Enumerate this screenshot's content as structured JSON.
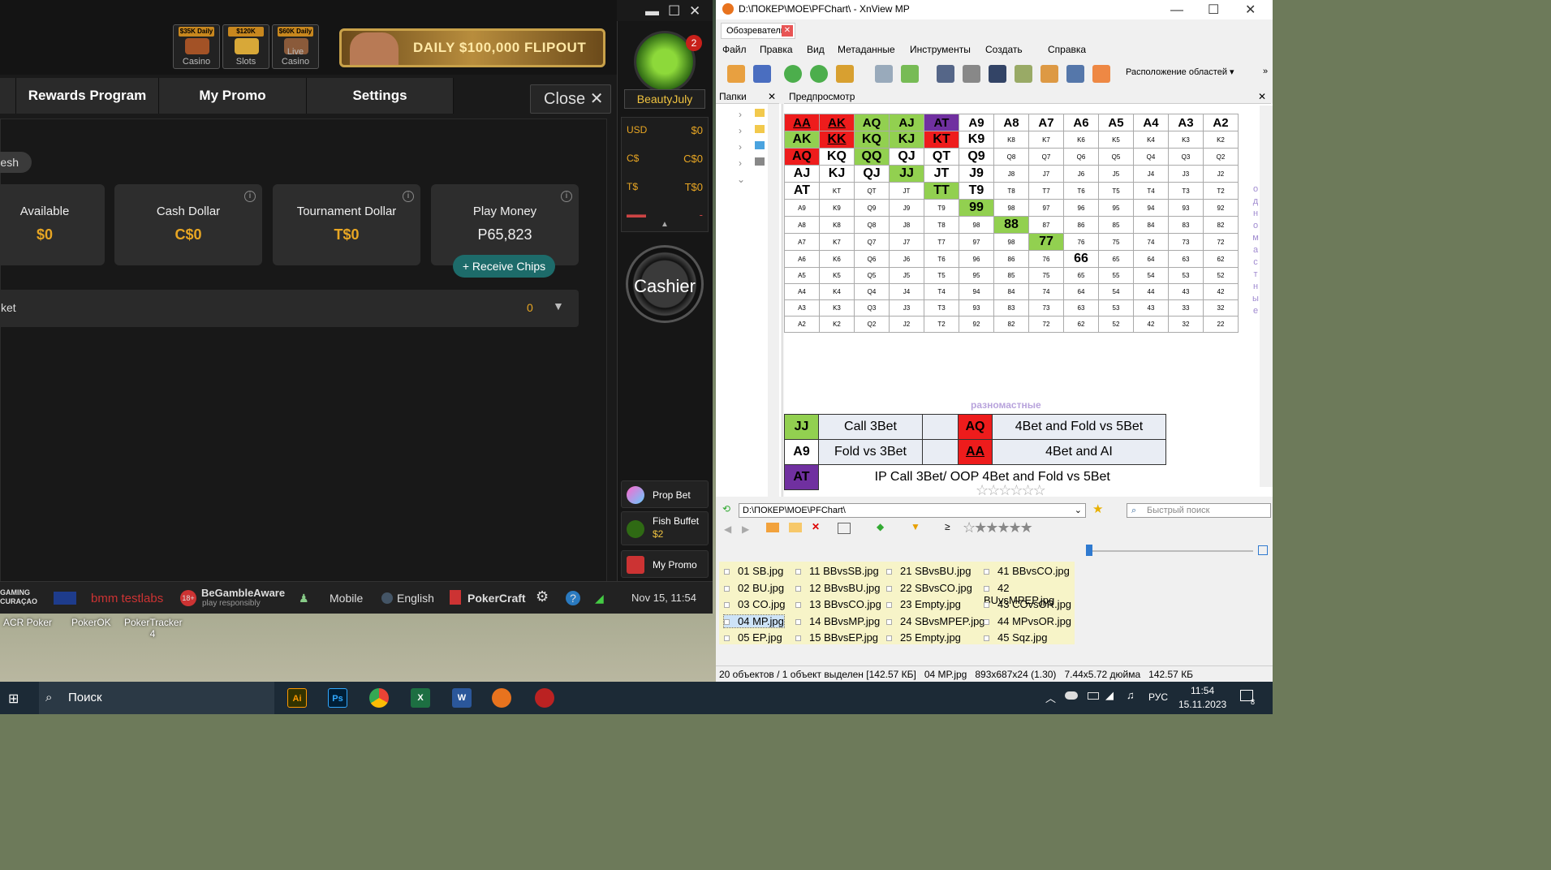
{
  "poker": {
    "games": [
      {
        "banner": "$35K Daily",
        "label": "Casino"
      },
      {
        "banner": "$120K Daily",
        "label": "Slots"
      },
      {
        "banner": "$60K Daily",
        "label": "Live Casino"
      }
    ],
    "flipout": "DAILY $100,000 FLIPOUT",
    "tabs": [
      "Rewards Program",
      "My Promo",
      "Settings"
    ],
    "close": "Close ✕",
    "refresh": "esh",
    "cards": [
      {
        "title": "Available",
        "value": "$0"
      },
      {
        "title": "Cash Dollar",
        "value": "C$0"
      },
      {
        "title": "Tournament Dollar",
        "value": "T$0"
      },
      {
        "title": "Play Money",
        "value": "P65,823"
      }
    ],
    "receive": "+ Receive Chips",
    "ticket": {
      "label": "ket",
      "count": "0"
    },
    "rail": {
      "badge": "2",
      "user": "BeautyJuly",
      "bal": [
        {
          "l": "USD",
          "r": "$0"
        },
        {
          "l": "C$",
          "r": "C$0"
        },
        {
          "l": "T$",
          "r": "T$0"
        },
        {
          "l": "",
          "r": "-"
        }
      ],
      "cashier": "Cashier",
      "items": [
        {
          "label": "Prop Bet"
        },
        {
          "label": "Fish Buffet",
          "sub": "$2"
        },
        {
          "label": "My Promo"
        }
      ]
    },
    "footer": {
      "gaming": "GAMING CURAÇAO",
      "bmm": "bmm testlabs",
      "gamble": "BeGambleAware",
      "gamble_sub": "play responsibly",
      "age": "18+",
      "mobile": "Mobile",
      "lang": "English",
      "pt": "PokerCraft",
      "date": "Nov 15, 11:54"
    }
  },
  "desktop": [
    "ACR Poker",
    "PokerOK",
    "PokerTracker 4"
  ],
  "xnview": {
    "title": "D:\\ПОКЕР\\МОЕ\\PFChart\\ - XnView MP",
    "tab": "Обозреватель",
    "menu": [
      "Файл",
      "Правка",
      "Вид",
      "Метаданные",
      "Инструменты",
      "Создать",
      "Справка"
    ],
    "layout": "Расположение областей",
    "folders": "Папки",
    "preview": "Предпросмотр",
    "address": "D:\\ПОКЕР\\МОЕ\\PFChart\\",
    "search": "Быстрый поиск",
    "files": [
      [
        "01 SB.jpg",
        "02 BU.jpg",
        "03 CO.jpg",
        "04 MP.jpg",
        "05 EP.jpg"
      ],
      [
        "11 BBvsSB.jpg",
        "12 BBvsBU.jpg",
        "13 BBvsCO.jpg",
        "14 BBvsMP.jpg",
        "15 BBvsEP.jpg"
      ],
      [
        "21 SBvsBU.jpg",
        "22 SBvsCO.jpg",
        "23 Empty.jpg",
        "24 SBvsMPEP.jpg",
        "25 Empty.jpg"
      ],
      [
        "41 BBvsCO.jpg",
        "42 BUvsMPEP.jpg",
        "43 COvsOR.jpg",
        "44 MPvsOR.jpg",
        "45 Sqz.jpg"
      ]
    ],
    "status": [
      "20 объектов / 1 объект выделен [142.57 КБ]",
      "04 MP.jpg",
      "893x687x24 (1.30)",
      "7.44x5.72 дюйма",
      "142.57 КБ"
    ]
  },
  "chart": {
    "rows": [
      [
        "AA",
        "AK",
        "AQ",
        "AJ",
        "AT",
        "A9",
        "A8",
        "A7",
        "A6",
        "A5",
        "A4",
        "A3",
        "A2"
      ],
      [
        "AK",
        "KK",
        "KQ",
        "KJ",
        "KT",
        "K9",
        "K8",
        "K7",
        "K6",
        "K5",
        "K4",
        "K3",
        "K2"
      ],
      [
        "AQ",
        "KQ",
        "QQ",
        "QJ",
        "QT",
        "Q9",
        "Q8",
        "Q7",
        "Q6",
        "Q5",
        "Q4",
        "Q3",
        "Q2"
      ],
      [
        "AJ",
        "KJ",
        "QJ",
        "JJ",
        "JT",
        "J9",
        "J8",
        "J7",
        "J6",
        "J5",
        "J4",
        "J3",
        "J2"
      ],
      [
        "AT",
        "KT",
        "QT",
        "JT",
        "TT",
        "T9",
        "T8",
        "T7",
        "T6",
        "T5",
        "T4",
        "T3",
        "T2"
      ],
      [
        "A9",
        "K9",
        "Q9",
        "J9",
        "T9",
        "99",
        "98",
        "97",
        "96",
        "95",
        "94",
        "93",
        "92"
      ],
      [
        "A8",
        "K8",
        "Q8",
        "J8",
        "T8",
        "98",
        "88",
        "87",
        "86",
        "85",
        "84",
        "83",
        "82"
      ],
      [
        "A7",
        "K7",
        "Q7",
        "J7",
        "T7",
        "97",
        "98",
        "77",
        "76",
        "75",
        "74",
        "73",
        "72"
      ],
      [
        "A6",
        "K6",
        "Q6",
        "J6",
        "T6",
        "96",
        "86",
        "76",
        "66",
        "65",
        "64",
        "63",
        "62"
      ],
      [
        "A5",
        "K5",
        "Q5",
        "J5",
        "T5",
        "95",
        "85",
        "75",
        "65",
        "55",
        "54",
        "53",
        "52"
      ],
      [
        "A4",
        "K4",
        "Q4",
        "J4",
        "T4",
        "94",
        "84",
        "74",
        "64",
        "54",
        "44",
        "43",
        "42"
      ],
      [
        "A3",
        "K3",
        "Q3",
        "J3",
        "T3",
        "93",
        "83",
        "73",
        "63",
        "53",
        "43",
        "33",
        "32"
      ],
      [
        "A2",
        "K2",
        "Q2",
        "J2",
        "T2",
        "92",
        "82",
        "72",
        "62",
        "52",
        "42",
        "32",
        "22"
      ]
    ],
    "offsuit": "разномастные",
    "suited": "одномастные",
    "legend": [
      [
        "JJ",
        "Call 3Bet",
        "AQ",
        "4Bet and Fold vs 5Bet"
      ],
      [
        "A9",
        "Fold vs 3Bet",
        "AA",
        "4Bet and AI"
      ],
      [
        "AT",
        "IP Call 3Bet/ OOP 4Bet and Fold vs 5Bet"
      ]
    ]
  },
  "taskbar": {
    "search": "Поиск",
    "lang": "РУС",
    "time": "11:54",
    "date": "15.11.2023",
    "notif": "8"
  }
}
